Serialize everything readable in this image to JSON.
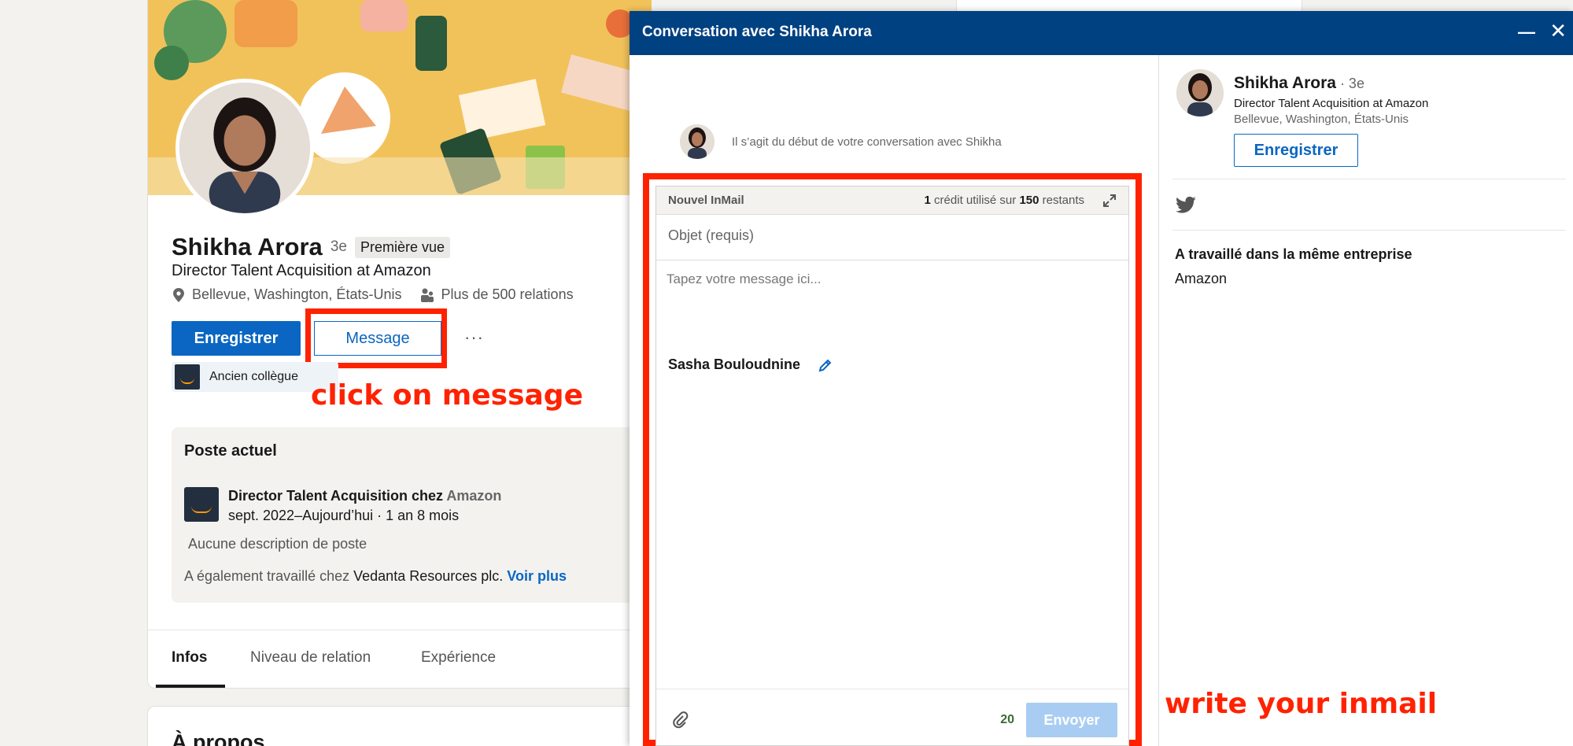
{
  "profile": {
    "name": "Shikha Arora",
    "degree": "3e",
    "first_view_badge": "Première vue",
    "headline": "Director Talent Acquisition at Amazon",
    "location": "Bellevue, Washington, États-Unis",
    "connections": "Plus de 500 relations",
    "save_label": "Enregistrer",
    "message_label": "Message",
    "more_label": "···",
    "colleague_chip": "Ancien collègue"
  },
  "current_position": {
    "title": "Poste actuel",
    "role": "Director Talent Acquisition chez",
    "company": "Amazon",
    "dates": "sept. 2022–Aujourd’hui · 1 an 8 mois",
    "no_description": "Aucune description de poste",
    "also_worked_prefix": "A également travaillé chez",
    "also_worked_company": "Vedanta Resources plc.",
    "see_more": "Voir plus"
  },
  "tabs": [
    {
      "label": "Infos"
    },
    {
      "label": "Niveau de relation"
    },
    {
      "label": "Expérience"
    }
  ],
  "about_title": "À propos",
  "annotations": {
    "click": "click on message",
    "write": "write your inmail"
  },
  "conversation": {
    "title": "Conversation avec Shikha Arora",
    "minimize": "—",
    "close": "✕",
    "start_text": "Il s’agit du début de votre conversation avec Shikha",
    "inmail_label": "Nouvel InMail",
    "credits_used": "1",
    "credits_middle": " crédit utilisé sur ",
    "credits_left": "150",
    "credits_suffix": " restants",
    "subject_placeholder": "Objet (requis)",
    "body_placeholder": "Tapez votre message ici...",
    "signature": "Sasha Bouloudnine",
    "char_count": "20",
    "send_label": "Envoyer"
  },
  "side_panel": {
    "name": "Shikha Arora",
    "degree": " · 3e",
    "headline": "Director Talent Acquisition at Amazon",
    "location": "Bellevue, Washington, États-Unis",
    "save_label": "Enregistrer",
    "worked_same_company": "A travaillé dans la même entreprise",
    "company": "Amazon"
  },
  "colors": {
    "linkedin_blue": "#0a66c2",
    "header_blue": "#004182",
    "annotation_red": "#ff2200",
    "send_disabled": "#a9cdf2"
  },
  "icons": [
    "location-pin-icon",
    "people-icon",
    "amazon-logo",
    "expand-icon",
    "pencil-icon",
    "paperclip-icon",
    "twitter-icon",
    "minimize-icon",
    "close-icon"
  ]
}
